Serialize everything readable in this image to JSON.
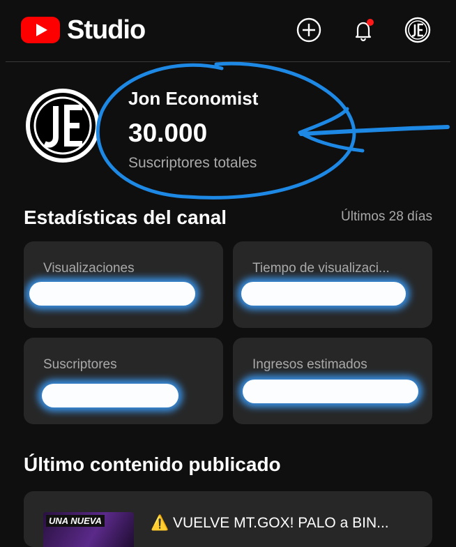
{
  "header": {
    "app_name": "Studio",
    "icons": [
      "youtube-logo",
      "plus-circle-icon",
      "bell-icon",
      "avatar"
    ]
  },
  "channel": {
    "avatar_text": "JE",
    "name": "Jon Economist",
    "subscriber_count": "30.000",
    "subscriber_label": "Suscriptores totales"
  },
  "stats": {
    "title": "Estadísticas del canal",
    "period": "Últimos 28 días",
    "cards": [
      {
        "label": "Visualizaciones"
      },
      {
        "label": "Tiempo de visualizaci..."
      },
      {
        "label": "Suscriptores"
      },
      {
        "label": "Ingresos estimados"
      }
    ]
  },
  "latest": {
    "title": "Último contenido publicado",
    "item": {
      "thumbnail_text": "UNA NUEVA",
      "title": "⚠️ VUELVE MT.GOX! PALO a BIN..."
    }
  },
  "colors": {
    "background": "#0f0f0f",
    "card": "#272727",
    "brand_red": "#ff0000",
    "annotation_blue": "#1e88e5",
    "redaction_glow": "#3ca0ff"
  }
}
